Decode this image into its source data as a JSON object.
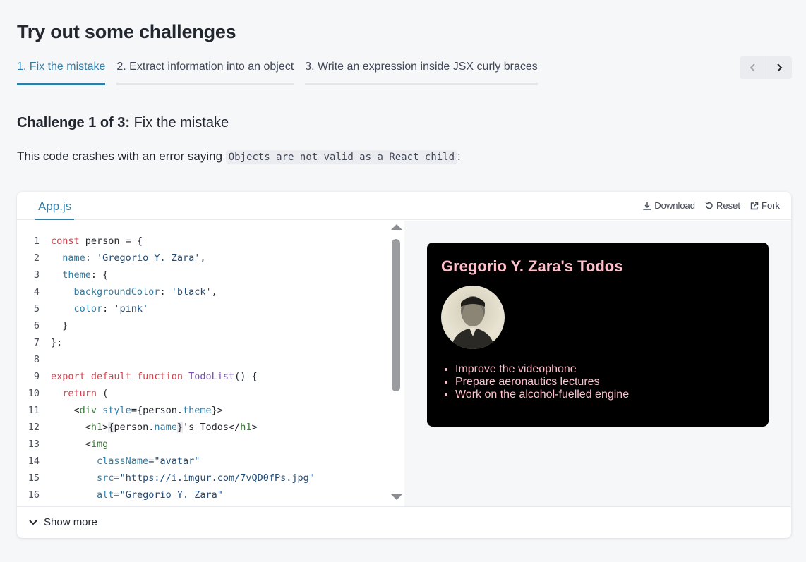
{
  "page": {
    "title": "Try out some challenges"
  },
  "tabs": [
    {
      "label": "1. Fix the mistake"
    },
    {
      "label": "2. Extract information into an object"
    },
    {
      "label": "3. Write an expression inside JSX curly braces"
    }
  ],
  "challenge": {
    "prefix": "Challenge 1 of 3:",
    "title": "Fix the mistake",
    "desc_before": "This code crashes with an error saying ",
    "desc_code": "Objects are not valid as a React child",
    "desc_after": ":"
  },
  "sandbox": {
    "file_tab": "App.js",
    "actions": {
      "download": "Download",
      "reset": "Reset",
      "fork": "Fork"
    },
    "show_more": "Show more",
    "line_numbers": [
      "1",
      "2",
      "3",
      "4",
      "5",
      "6",
      "7",
      "8",
      "9",
      "10",
      "11",
      "12",
      "13",
      "14",
      "15",
      "16"
    ]
  },
  "preview": {
    "title": "Gregorio Y. Zara's Todos",
    "todos": [
      "Improve the videophone",
      "Prepare aeronautics lectures",
      "Work on the alcohol-fuelled engine"
    ],
    "text_color": "#ffc0cb",
    "bg_color": "#000000"
  },
  "colors": {
    "accent": "#2f7ea7",
    "page_bg": "#f6f7f9"
  }
}
